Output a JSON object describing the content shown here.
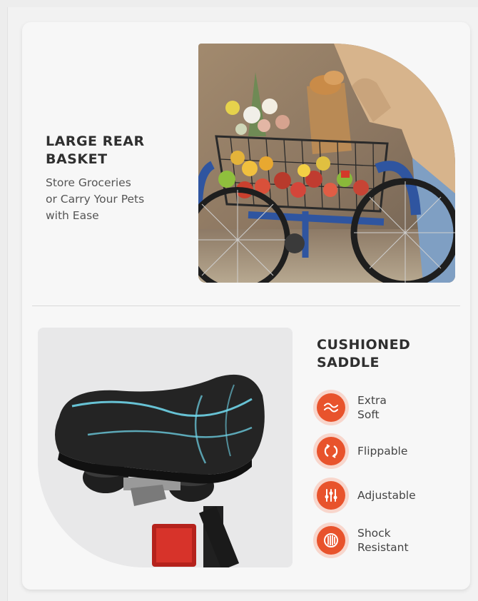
{
  "basket_section": {
    "title": "LARGE REAR\nBASKET",
    "subtitle": "Store Groceries\nor Carry Your Pets\nwith Ease"
  },
  "saddle_section": {
    "title": "CUSHIONED\nSADDLE",
    "features": [
      {
        "label": "Extra\nSoft",
        "icon": "wave-icon"
      },
      {
        "label": "Flippable",
        "icon": "flip-icon"
      },
      {
        "label": "Adjustable",
        "icon": "sliders-icon"
      },
      {
        "label": "Shock\nResistant",
        "icon": "spring-icon"
      }
    ]
  },
  "colors": {
    "accent": "#e8532c",
    "accent_ring": "#f8d6cc",
    "bike_blue": "#2f55a0"
  }
}
